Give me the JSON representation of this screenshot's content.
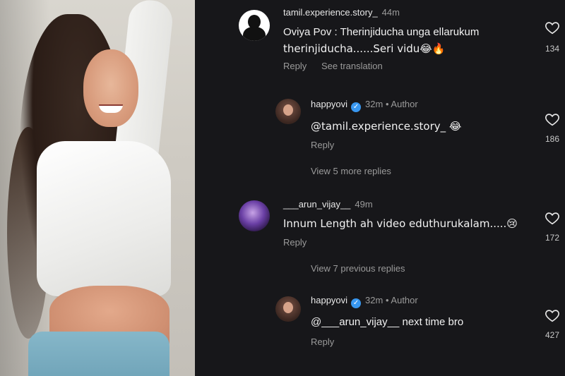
{
  "comments": [
    {
      "username": "tamil.experience.story_",
      "time": "44m",
      "text_line1": "Oviya Pov : Therinjiducha unga ellarukum",
      "text_line2": "therinjiducha......Seri vidu😂🔥",
      "reply_label": "Reply",
      "translate_label": "See translation",
      "likes": "134"
    },
    {
      "username": "happyovi",
      "time": "32m",
      "author_label": "• Author",
      "text": "@tamil.experience.story_ 😂",
      "reply_label": "Reply",
      "likes": "186"
    },
    {
      "view_more": "View 5 more replies"
    },
    {
      "username": "___arun_vijay__",
      "time": "49m",
      "text": "Innum Length ah video eduthurukalam.....😢",
      "reply_label": "Reply",
      "likes": "172"
    },
    {
      "view_previous": "View 7 previous replies"
    },
    {
      "username": "happyovi",
      "time": "32m",
      "author_label": "• Author",
      "text": "@___arun_vijay__ next time bro",
      "reply_label": "Reply",
      "likes": "427"
    }
  ],
  "icons": {
    "verified": "verified-badge-icon",
    "heart": "heart-outline-icon"
  },
  "colors": {
    "panel_bg": "#17171a",
    "secondary_text": "#9a9a9a",
    "verified_blue": "#3897f0"
  }
}
